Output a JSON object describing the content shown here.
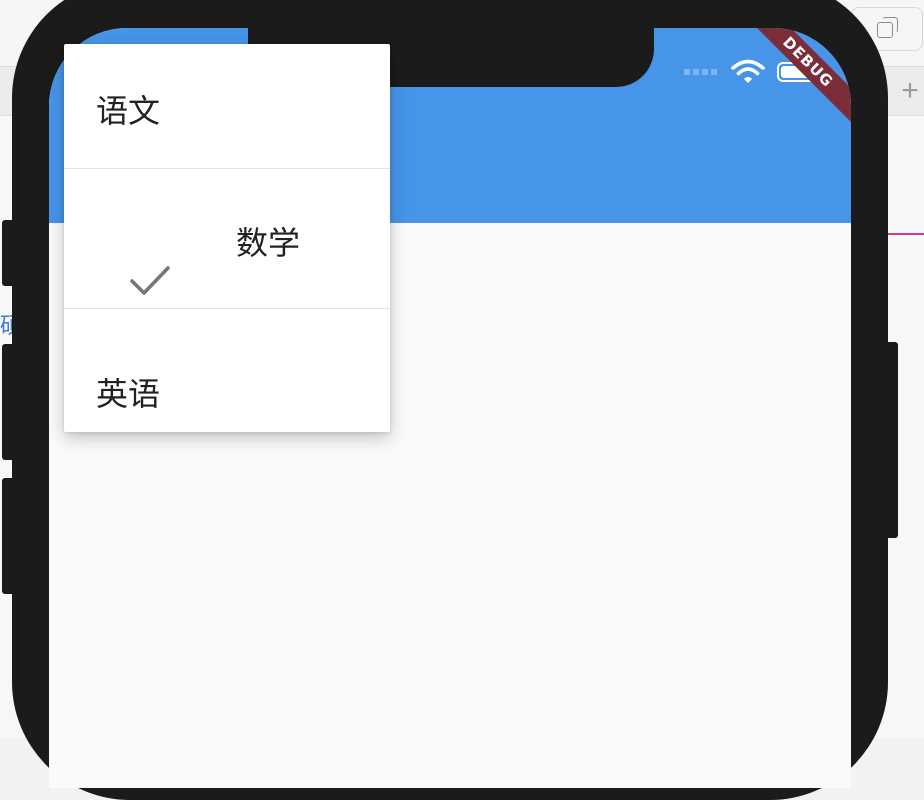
{
  "status_bar": {
    "icons": [
      "signal-icon",
      "wifi-icon",
      "battery-icon"
    ]
  },
  "debug_banner": {
    "text": "DEBUG",
    "color": "#7b2d3a"
  },
  "app_bar": {
    "color": "#4795e9"
  },
  "popup_menu": {
    "items": [
      {
        "label": "语文",
        "selected": false
      },
      {
        "label": "数学",
        "selected": true,
        "icon": "check-icon"
      },
      {
        "label": "英语",
        "selected": false
      }
    ]
  },
  "host": {
    "icons": [
      "duplicate-window-icon",
      "plus-icon"
    ],
    "side_link_text": "碩"
  }
}
